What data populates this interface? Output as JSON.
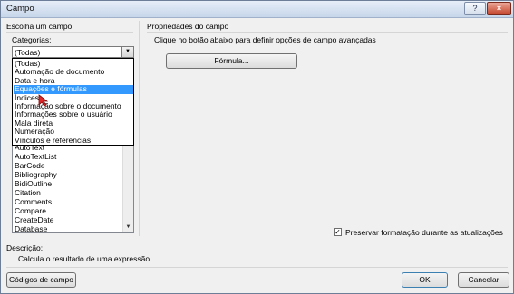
{
  "window": {
    "title": "Campo",
    "help_label": "?",
    "close_label": "×"
  },
  "left": {
    "section_title": "Escolha um campo",
    "categories_label": "Categorias:",
    "categories_selected": "(Todas)",
    "dropdown_options": [
      "(Todas)",
      "Automação de documento",
      "Data e hora",
      "Equações e fórmulas",
      "Índices",
      "Informação sobre o documento",
      "Informações sobre o usuário",
      "Mala direta",
      "Numeração",
      "Vínculos e referências"
    ],
    "highlighted_option": "Equações e fórmulas",
    "field_names_visible": [
      "AutoText",
      "AutoTextList",
      "BarCode",
      "Bibliography",
      "BidiOutline",
      "Citation",
      "Comments",
      "Compare",
      "CreateDate",
      "Database"
    ]
  },
  "right": {
    "section_title": "Propriedades do campo",
    "instruction": "Clique no botão abaixo para definir opções de campo avançadas",
    "formula_button": "Fórmula...",
    "preserve_checkbox_label": "Preservar formatação durante as atualizações",
    "preserve_checked": true,
    "check_glyph": "✓"
  },
  "description": {
    "label": "Descrição:",
    "text": "Calcula o resultado de uma expressão"
  },
  "buttons": {
    "field_codes": "Códigos de campo",
    "ok": "OK",
    "cancel": "Cancelar"
  },
  "colors": {
    "selection": "#3399ff",
    "cursor_red": "#e0282b"
  }
}
